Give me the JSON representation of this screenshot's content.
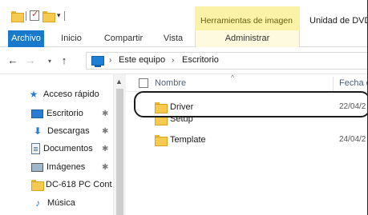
{
  "ribbon": {
    "tools_header": "Herramientas de imagen",
    "window_title": "Unidad de DVD",
    "tabs": {
      "file": "Archivo",
      "home": "Inicio",
      "share": "Compartir",
      "view": "Vista",
      "manage": "Administrar"
    }
  },
  "address": {
    "crumbs": [
      "Este equipo",
      "Escritorio"
    ],
    "separator": "›"
  },
  "sidebar": {
    "items": [
      {
        "label": "Acceso rápido",
        "icon": "star-icon"
      },
      {
        "label": "Escritorio",
        "icon": "desktop-icon",
        "pinned": true
      },
      {
        "label": "Descargas",
        "icon": "download-icon",
        "pinned": true
      },
      {
        "label": "Documentos",
        "icon": "document-icon",
        "pinned": true
      },
      {
        "label": "Imágenes",
        "icon": "pictures-icon",
        "pinned": true
      },
      {
        "label": "DC-618 PC Cont",
        "icon": "folder-icon",
        "pinned": false
      },
      {
        "label": "Música",
        "icon": "music-icon",
        "pinned": false
      }
    ]
  },
  "filelist": {
    "columns": {
      "name": "Nombre",
      "date": "Fecha d"
    },
    "rows": [
      {
        "name": "Driver",
        "date": "22/04/2"
      },
      {
        "name": "Setup",
        "date": ""
      },
      {
        "name": "Template",
        "date": "24/04/2"
      }
    ]
  },
  "colors": {
    "file_tab": "#1979ca",
    "tools_header": "#fbf2a8",
    "folder": "#f6c950",
    "accent_blue": "#2b7cd3"
  }
}
